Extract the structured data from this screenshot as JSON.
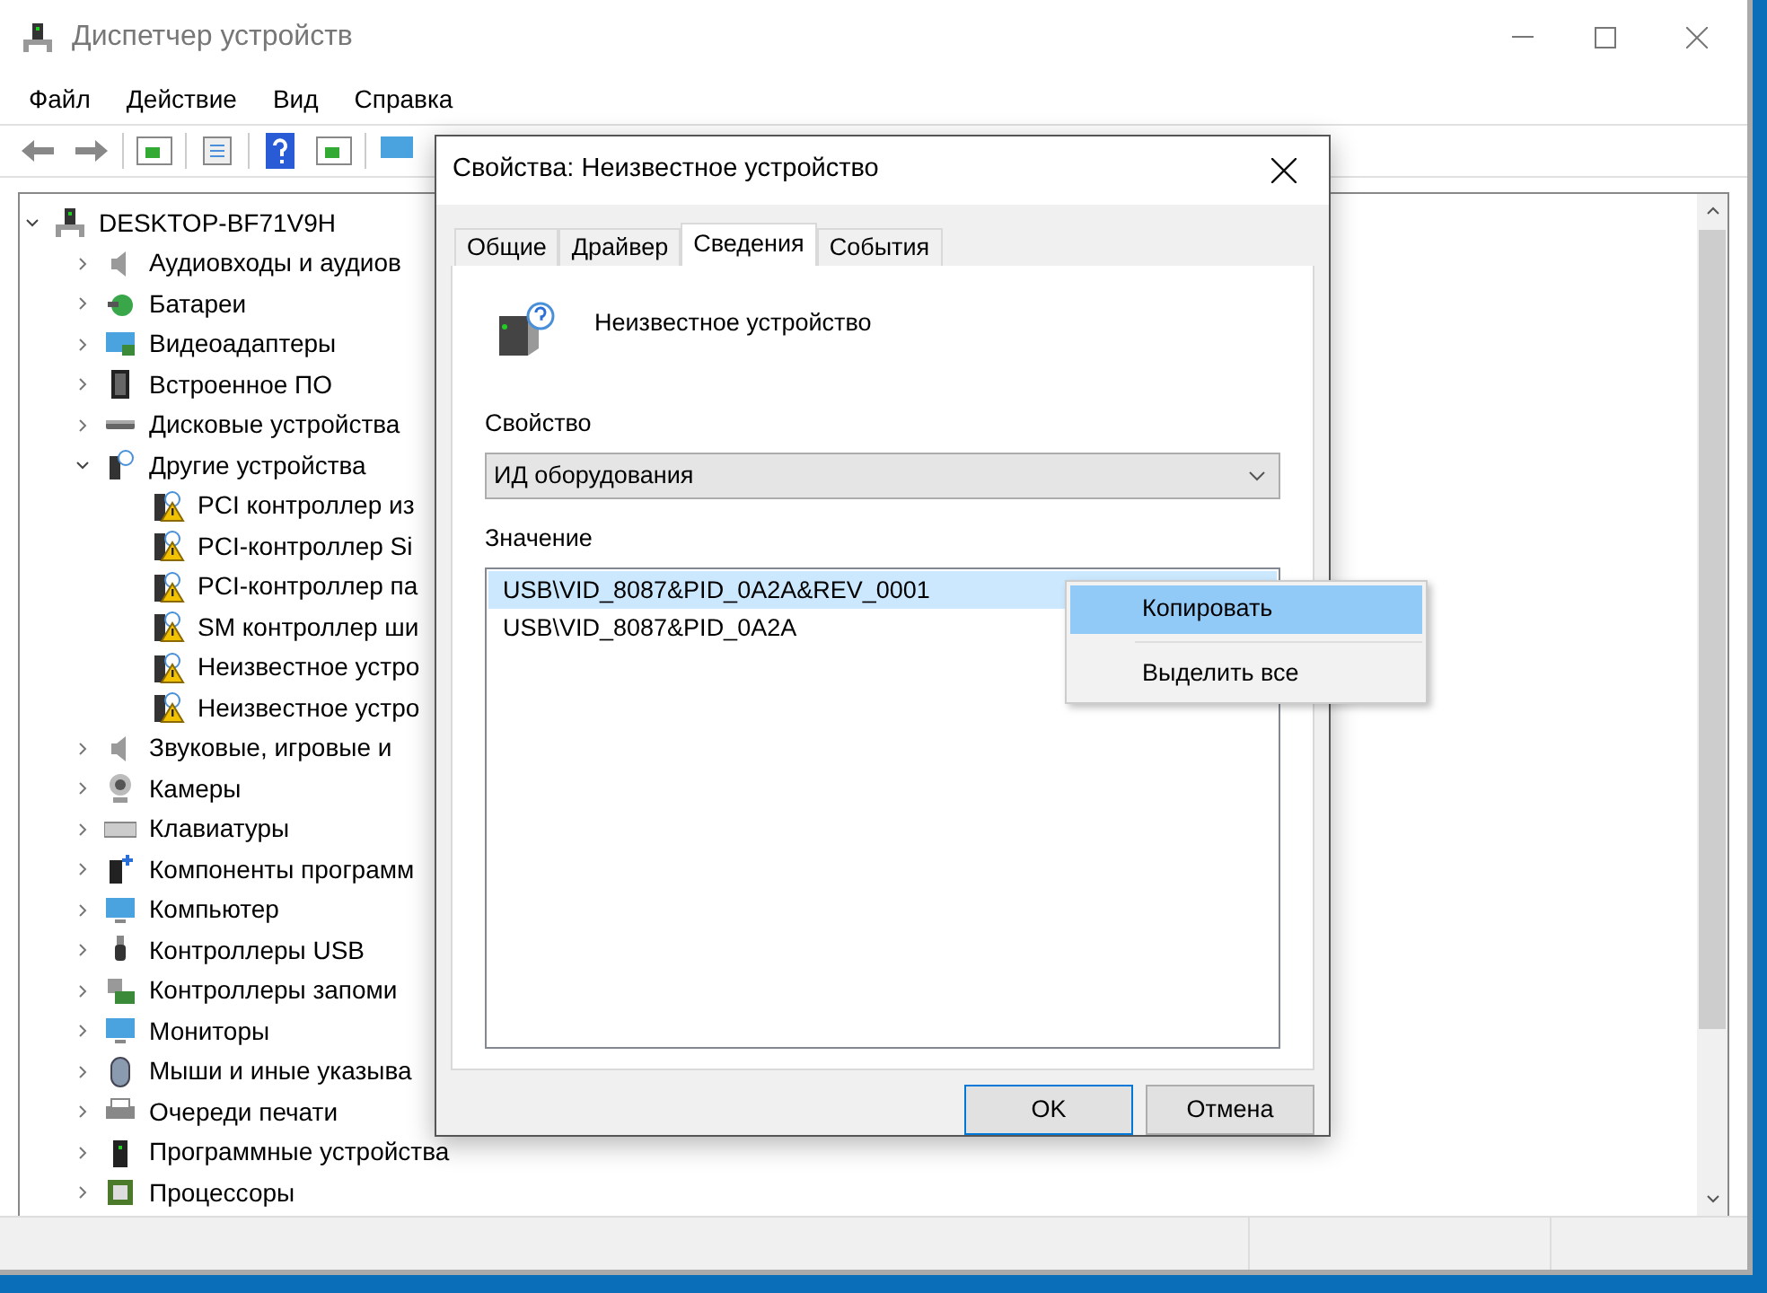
{
  "window": {
    "title": "Диспетчер устройств"
  },
  "menu": [
    "Файл",
    "Действие",
    "Вид",
    "Справка"
  ],
  "tree": [
    {
      "label": "DESKTOP-BF71V9H",
      "expanded": true,
      "children": [
        {
          "label": "Аудиовходы и аудиов",
          "expanded": false
        },
        {
          "label": "Батареи",
          "expanded": false
        },
        {
          "label": "Видеоадаптеры",
          "expanded": false
        },
        {
          "label": "Встроенное ПО",
          "expanded": false
        },
        {
          "label": "Дисковые устройства",
          "expanded": false
        },
        {
          "label": "Другие устройства",
          "expanded": true,
          "children": [
            {
              "label": "PCI контроллер из"
            },
            {
              "label": "PCI-контроллер Si"
            },
            {
              "label": "PCI-контроллер па"
            },
            {
              "label": "SM контроллер ши"
            },
            {
              "label": "Неизвестное устро"
            },
            {
              "label": "Неизвестное устро"
            }
          ]
        },
        {
          "label": "Звуковые, игровые и",
          "expanded": false
        },
        {
          "label": "Камеры",
          "expanded": false
        },
        {
          "label": "Клавиатуры",
          "expanded": false
        },
        {
          "label": "Компоненты программ",
          "expanded": false
        },
        {
          "label": "Компьютер",
          "expanded": false
        },
        {
          "label": "Контроллеры USB",
          "expanded": false
        },
        {
          "label": "Контроллеры запоми",
          "expanded": false
        },
        {
          "label": "Мониторы",
          "expanded": false
        },
        {
          "label": "Мыши и иные указыва",
          "expanded": false
        },
        {
          "label": "Очереди печати",
          "expanded": false
        },
        {
          "label": "Программные устройства",
          "expanded": false
        },
        {
          "label": "Процессоры",
          "expanded": false
        }
      ]
    }
  ],
  "dialog": {
    "title": "Свойства: Неизвестное устройство",
    "tabs": [
      {
        "label": "Общие",
        "selected": false
      },
      {
        "label": "Драйвер",
        "selected": false
      },
      {
        "label": "Сведения",
        "selected": true
      },
      {
        "label": "События",
        "selected": false
      }
    ],
    "device_name": "Неизвестное устройство",
    "property_label": "Свойство",
    "property_value": "ИД оборудования",
    "value_label": "Значение",
    "values": [
      {
        "text": "USB\\VID_8087&PID_0A2A&REV_0001",
        "selected": true
      },
      {
        "text": "USB\\VID_8087&PID_0A2A",
        "selected": false
      }
    ],
    "buttons": [
      {
        "label": "OK",
        "default": true
      },
      {
        "label": "Отмена",
        "default": false
      }
    ]
  },
  "context_menu": [
    {
      "label": "Копировать",
      "selected": true
    },
    {
      "label": "Выделить все",
      "selected": false
    }
  ]
}
